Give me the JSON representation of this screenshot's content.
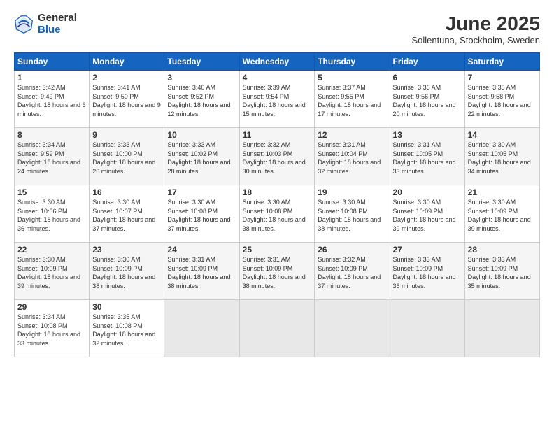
{
  "header": {
    "logo_general": "General",
    "logo_blue": "Blue",
    "month_title": "June 2025",
    "location": "Sollentuna, Stockholm, Sweden"
  },
  "days_of_week": [
    "Sunday",
    "Monday",
    "Tuesday",
    "Wednesday",
    "Thursday",
    "Friday",
    "Saturday"
  ],
  "weeks": [
    [
      {
        "day": "1",
        "sunrise": "3:42 AM",
        "sunset": "9:49 PM",
        "daylight": "18 hours and 6 minutes."
      },
      {
        "day": "2",
        "sunrise": "3:41 AM",
        "sunset": "9:50 PM",
        "daylight": "18 hours and 9 minutes."
      },
      {
        "day": "3",
        "sunrise": "3:40 AM",
        "sunset": "9:52 PM",
        "daylight": "18 hours and 12 minutes."
      },
      {
        "day": "4",
        "sunrise": "3:39 AM",
        "sunset": "9:54 PM",
        "daylight": "18 hours and 15 minutes."
      },
      {
        "day": "5",
        "sunrise": "3:37 AM",
        "sunset": "9:55 PM",
        "daylight": "18 hours and 17 minutes."
      },
      {
        "day": "6",
        "sunrise": "3:36 AM",
        "sunset": "9:56 PM",
        "daylight": "18 hours and 20 minutes."
      },
      {
        "day": "7",
        "sunrise": "3:35 AM",
        "sunset": "9:58 PM",
        "daylight": "18 hours and 22 minutes."
      }
    ],
    [
      {
        "day": "8",
        "sunrise": "3:34 AM",
        "sunset": "9:59 PM",
        "daylight": "18 hours and 24 minutes."
      },
      {
        "day": "9",
        "sunrise": "3:33 AM",
        "sunset": "10:00 PM",
        "daylight": "18 hours and 26 minutes."
      },
      {
        "day": "10",
        "sunrise": "3:33 AM",
        "sunset": "10:02 PM",
        "daylight": "18 hours and 28 minutes."
      },
      {
        "day": "11",
        "sunrise": "3:32 AM",
        "sunset": "10:03 PM",
        "daylight": "18 hours and 30 minutes."
      },
      {
        "day": "12",
        "sunrise": "3:31 AM",
        "sunset": "10:04 PM",
        "daylight": "18 hours and 32 minutes."
      },
      {
        "day": "13",
        "sunrise": "3:31 AM",
        "sunset": "10:05 PM",
        "daylight": "18 hours and 33 minutes."
      },
      {
        "day": "14",
        "sunrise": "3:30 AM",
        "sunset": "10:05 PM",
        "daylight": "18 hours and 34 minutes."
      }
    ],
    [
      {
        "day": "15",
        "sunrise": "3:30 AM",
        "sunset": "10:06 PM",
        "daylight": "18 hours and 36 minutes."
      },
      {
        "day": "16",
        "sunrise": "3:30 AM",
        "sunset": "10:07 PM",
        "daylight": "18 hours and 37 minutes."
      },
      {
        "day": "17",
        "sunrise": "3:30 AM",
        "sunset": "10:08 PM",
        "daylight": "18 hours and 37 minutes."
      },
      {
        "day": "18",
        "sunrise": "3:30 AM",
        "sunset": "10:08 PM",
        "daylight": "18 hours and 38 minutes."
      },
      {
        "day": "19",
        "sunrise": "3:30 AM",
        "sunset": "10:08 PM",
        "daylight": "18 hours and 38 minutes."
      },
      {
        "day": "20",
        "sunrise": "3:30 AM",
        "sunset": "10:09 PM",
        "daylight": "18 hours and 39 minutes."
      },
      {
        "day": "21",
        "sunrise": "3:30 AM",
        "sunset": "10:09 PM",
        "daylight": "18 hours and 39 minutes."
      }
    ],
    [
      {
        "day": "22",
        "sunrise": "3:30 AM",
        "sunset": "10:09 PM",
        "daylight": "18 hours and 39 minutes."
      },
      {
        "day": "23",
        "sunrise": "3:30 AM",
        "sunset": "10:09 PM",
        "daylight": "18 hours and 38 minutes."
      },
      {
        "day": "24",
        "sunrise": "3:31 AM",
        "sunset": "10:09 PM",
        "daylight": "18 hours and 38 minutes."
      },
      {
        "day": "25",
        "sunrise": "3:31 AM",
        "sunset": "10:09 PM",
        "daylight": "18 hours and 38 minutes."
      },
      {
        "day": "26",
        "sunrise": "3:32 AM",
        "sunset": "10:09 PM",
        "daylight": "18 hours and 37 minutes."
      },
      {
        "day": "27",
        "sunrise": "3:33 AM",
        "sunset": "10:09 PM",
        "daylight": "18 hours and 36 minutes."
      },
      {
        "day": "28",
        "sunrise": "3:33 AM",
        "sunset": "10:09 PM",
        "daylight": "18 hours and 35 minutes."
      }
    ],
    [
      {
        "day": "29",
        "sunrise": "3:34 AM",
        "sunset": "10:08 PM",
        "daylight": "18 hours and 33 minutes."
      },
      {
        "day": "30",
        "sunrise": "3:35 AM",
        "sunset": "10:08 PM",
        "daylight": "18 hours and 32 minutes."
      },
      null,
      null,
      null,
      null,
      null
    ]
  ]
}
